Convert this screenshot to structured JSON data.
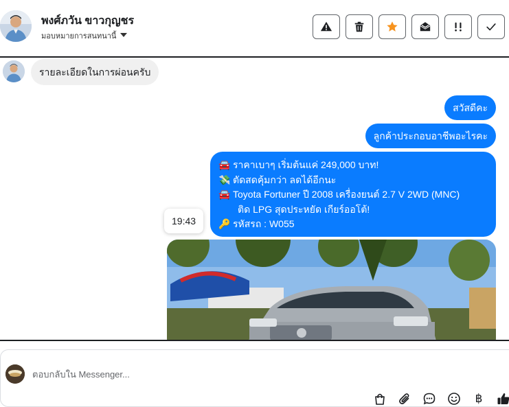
{
  "header": {
    "contact_name": "พงศ์ภวัน ขาวกุญชร",
    "assign_label": "มอบหมายการสนทนานี้",
    "actions": [
      {
        "name": "warning-icon",
        "label": "Mark as spam"
      },
      {
        "name": "trash-icon",
        "label": "Delete"
      },
      {
        "name": "star-icon",
        "label": "Star"
      },
      {
        "name": "envelope-open-icon",
        "label": "Mark as unread"
      },
      {
        "name": "follow-up-icon",
        "label": "Follow up"
      },
      {
        "name": "check-icon",
        "label": "Mark as done"
      }
    ],
    "star_color": "#f7931e"
  },
  "messages": {
    "incoming": "รายละเอียดในการผ่อนครับ",
    "outgoing_1": "สวัสดีคะ",
    "outgoing_2": "ลูกค้าประกอบอาชีพอะไรคะ",
    "details": {
      "line1_emoji": "🚘",
      "line1": "ราคาเบาๆ เริ่มต้นแค่ 249,000 บาท!",
      "line2_emoji": "💸",
      "line2": "ตัดสดคุ้มกว่า ลดได้อีกนะ",
      "line3_emoji": "🚘",
      "line3": "Toyota Fortuner ปี 2008 เครื่องยนต์ 2.7 V 2WD (MNC)",
      "line4": "ติด LPG สุดประหยัด เกียร์ออโต้!",
      "line5_emoji": "🔑",
      "line5": "รหัสรถ : W055"
    },
    "timestamp": "19:43",
    "bubble_color": "#0a7cff",
    "photo_icon": "car-photo"
  },
  "composer": {
    "placeholder": "ตอบกลับใน Messenger...",
    "tools": [
      "shopping-bag-icon",
      "paperclip-icon",
      "saved-reply-icon",
      "emoji-icon",
      "baht-icon",
      "thumbs-up-icon"
    ],
    "baht_symbol": "฿"
  }
}
